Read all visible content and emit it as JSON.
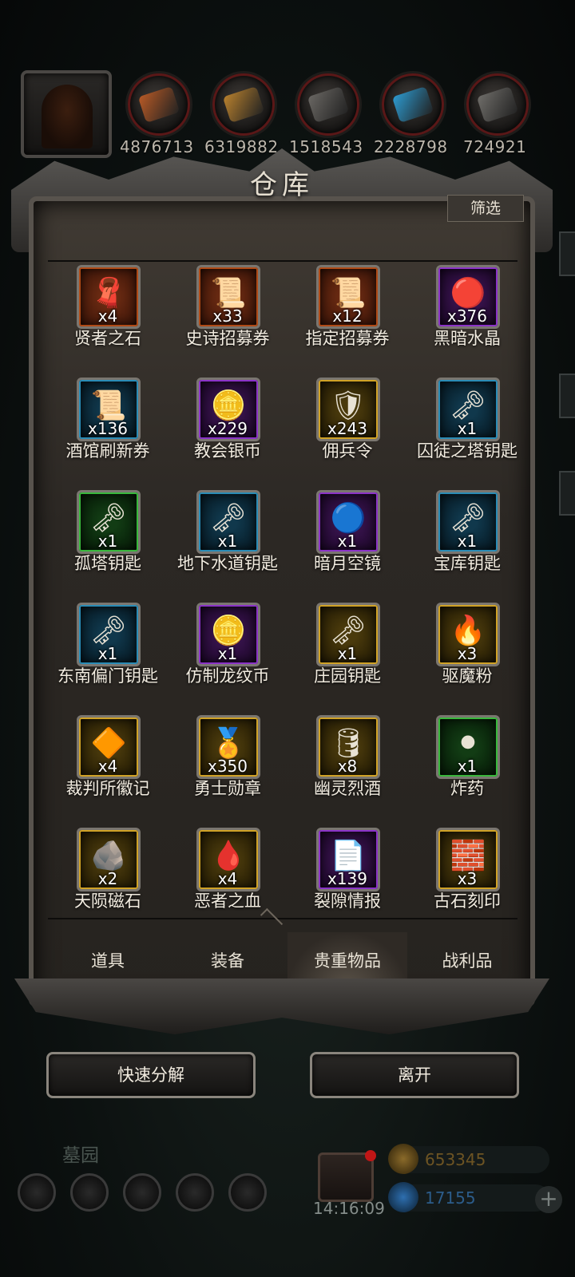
{
  "top_bar": {
    "resources": [
      {
        "icon": "food-icon",
        "value": "4876713",
        "color": "#b85a26"
      },
      {
        "icon": "wood-icon",
        "value": "6319882",
        "color": "#b9812e"
      },
      {
        "icon": "stone-icon",
        "value": "1518543",
        "color": "#6a6763"
      },
      {
        "icon": "crystal-icon",
        "value": "2228798",
        "color": "#2d9bd1"
      },
      {
        "icon": "iron-icon",
        "value": "724921",
        "color": "#6f6d69"
      }
    ]
  },
  "warehouse": {
    "title": "仓库",
    "filter_label": "筛选",
    "items": [
      {
        "name": "贤者之石",
        "count": "x4",
        "rarity": "orange",
        "icon": "cloth-stone-icon",
        "glyph": "🧣"
      },
      {
        "name": "史诗招募券",
        "count": "x33",
        "rarity": "orange",
        "icon": "scroll-icon",
        "glyph": "📜"
      },
      {
        "name": "指定招募券",
        "count": "x12",
        "rarity": "orange",
        "icon": "scroll-icon",
        "glyph": "📜"
      },
      {
        "name": "黑暗水晶",
        "count": "x376",
        "rarity": "purple",
        "icon": "crystal-icon",
        "glyph": "🔴"
      },
      {
        "name": "酒馆刷新券",
        "count": "x136",
        "rarity": "blue",
        "icon": "scroll-icon",
        "glyph": "📜"
      },
      {
        "name": "教会银币",
        "count": "x229",
        "rarity": "purple",
        "icon": "silver-coin-icon",
        "glyph": "🪙"
      },
      {
        "name": "佣兵令",
        "count": "x243",
        "rarity": "gold",
        "icon": "badge-icon",
        "glyph": "🛡"
      },
      {
        "name": "囚徒之塔钥匙",
        "count": "x1",
        "rarity": "blue",
        "icon": "key-icon",
        "glyph": "🗝"
      },
      {
        "name": "孤塔钥匙",
        "count": "x1",
        "rarity": "green",
        "icon": "key-icon",
        "glyph": "🗝"
      },
      {
        "name": "地下水道钥匙",
        "count": "x1",
        "rarity": "blue",
        "icon": "key-icon",
        "glyph": "🗝"
      },
      {
        "name": "暗月空镜",
        "count": "x1",
        "rarity": "purple",
        "icon": "mirror-icon",
        "glyph": "🔵"
      },
      {
        "name": "宝库钥匙",
        "count": "x1",
        "rarity": "blue",
        "icon": "key-icon",
        "glyph": "🗝"
      },
      {
        "name": "东南偏门钥匙",
        "count": "x1",
        "rarity": "blue",
        "icon": "key-icon",
        "glyph": "🗝"
      },
      {
        "name": "仿制龙纹币",
        "count": "x1",
        "rarity": "purple",
        "icon": "silver-coin-icon",
        "glyph": "🪙"
      },
      {
        "name": "庄园钥匙",
        "count": "x1",
        "rarity": "gold",
        "icon": "key-icon",
        "glyph": "🗝"
      },
      {
        "name": "驱魔粉",
        "count": "x3",
        "rarity": "gold",
        "icon": "powder-icon",
        "glyph": "🔥"
      },
      {
        "name": "裁判所徽记",
        "count": "x4",
        "rarity": "gold",
        "icon": "emblem-icon",
        "glyph": "🔶"
      },
      {
        "name": "勇士勋章",
        "count": "x350",
        "rarity": "gold",
        "icon": "medal-icon",
        "glyph": "🏅"
      },
      {
        "name": "幽灵烈酒",
        "count": "x8",
        "rarity": "gold",
        "icon": "barrel-icon",
        "glyph": "🛢"
      },
      {
        "name": "炸药",
        "count": "x1",
        "rarity": "green",
        "icon": "explosive-icon",
        "glyph": "⚫"
      },
      {
        "name": "天陨磁石",
        "count": "x2",
        "rarity": "gold",
        "icon": "ore-icon",
        "glyph": "🪨"
      },
      {
        "name": "恶者之血",
        "count": "x4",
        "rarity": "gold",
        "icon": "blood-drop-icon",
        "glyph": "🩸"
      },
      {
        "name": "裂隙情报",
        "count": "x139",
        "rarity": "purple",
        "icon": "letter-icon",
        "glyph": "📄"
      },
      {
        "name": "古石刻印",
        "count": "x3",
        "rarity": "gold",
        "icon": "stone-seal-icon",
        "glyph": "🧱"
      }
    ],
    "tabs": [
      {
        "label": "道具",
        "active": false
      },
      {
        "label": "装备",
        "active": false
      },
      {
        "label": "贵重物品",
        "active": true
      },
      {
        "label": "战利品",
        "active": false
      }
    ]
  },
  "actions": {
    "quick_decompose": "快速分解",
    "leave": "离开"
  },
  "hud": {
    "zone_name": "墓园",
    "clock": "14:16:09",
    "gold": "653345",
    "gems": "17155",
    "gold_color": "#8a6a2a",
    "gem_color": "#2e6fb0"
  }
}
